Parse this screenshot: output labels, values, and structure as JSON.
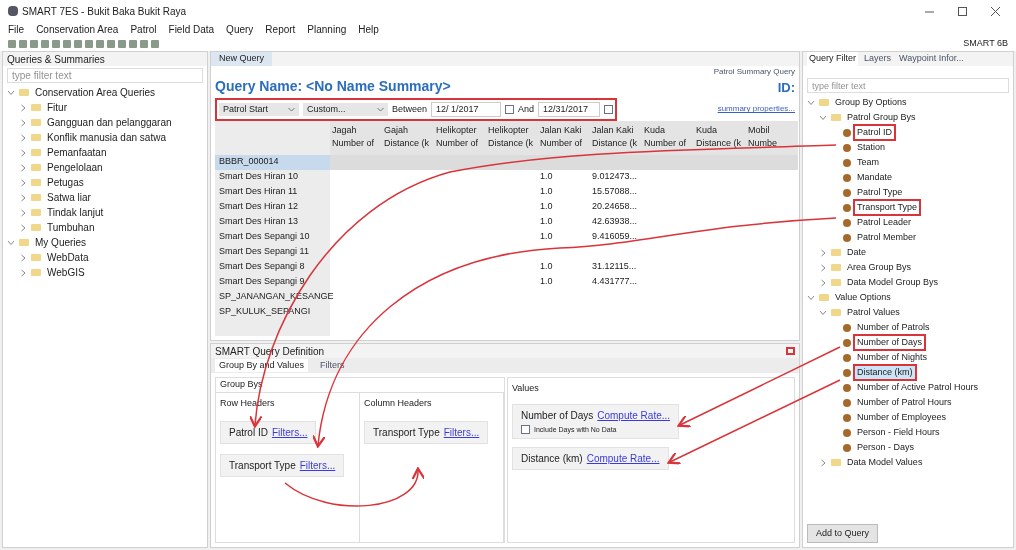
{
  "window": {
    "title": "SMART 7ES - Bukit Baka Bukit Raya"
  },
  "menu": [
    "File",
    "Conservation Area",
    "Patrol",
    "Field Data",
    "Query",
    "Report",
    "Planning",
    "Help"
  ],
  "toolbar_right": "SMART 6B",
  "left_panel": {
    "title": "Queries & Summaries",
    "filter_placeholder": "type filter text",
    "tree": [
      {
        "label": "Conservation Area Queries",
        "expanded": true,
        "children": [
          {
            "label": "Fitur",
            "expanded": false
          },
          {
            "label": "Gangguan dan pelanggaran",
            "expanded": false
          },
          {
            "label": "Konflik manusia dan satwa",
            "expanded": false
          },
          {
            "label": "Pemanfaatan",
            "expanded": false
          },
          {
            "label": "Pengelolaan",
            "expanded": false
          },
          {
            "label": "Petugas",
            "expanded": false
          },
          {
            "label": "Satwa liar",
            "expanded": false
          },
          {
            "label": "Tindak lanjut",
            "expanded": false
          },
          {
            "label": "Tumbuhan",
            "expanded": false
          }
        ]
      },
      {
        "label": "My Queries",
        "expanded": true,
        "children": [
          {
            "label": "WebData",
            "expanded": false
          },
          {
            "label": "WebGIS",
            "expanded": false
          }
        ]
      }
    ]
  },
  "editor": {
    "tab": "New Query",
    "query_name": "Query Name: <No Name Summary>",
    "query_type": "Patrol Summary Query",
    "id_label": "ID:",
    "filter_row": {
      "highlighted": true,
      "date_field": "Patrol Start",
      "range": "Custom...",
      "between_label": "Between",
      "start_date": "12/ 1/2017",
      "and_label": "And",
      "end_date": "12/31/2017"
    },
    "properties_link": "summary properties...",
    "table": {
      "columns": [
        [
          "Jagah",
          "Number of"
        ],
        [
          "Gajah",
          "Distance (k"
        ],
        [
          "Helikopter",
          "Number of"
        ],
        [
          "Helikopter",
          "Distance (k"
        ],
        [
          "Jalan Kaki",
          "Number of"
        ],
        [
          "Jalan Kaki",
          "Distance (k"
        ],
        [
          "Kuda",
          "Number of"
        ],
        [
          "Kuda",
          "Distance (k"
        ],
        [
          "Mobil",
          "Numbe"
        ]
      ],
      "rows": [
        {
          "label": "BBBR_000014",
          "selected": true
        },
        {
          "label": "Smart Des Hiran 10",
          "selected": false,
          "walk_number": "1.0",
          "walk_distance": "9.012473..."
        },
        {
          "label": "Smart Des Hiran 11",
          "selected": false,
          "walk_number": "1.0",
          "walk_distance": "15.57088..."
        },
        {
          "label": "Smart Des Hiran 12",
          "selected": false,
          "walk_number": "1.0",
          "walk_distance": "20.24658..."
        },
        {
          "label": "Smart Des Hiran 13",
          "selected": false,
          "walk_number": "1.0",
          "walk_distance": "42.63938..."
        },
        {
          "label": "Smart Des Sepangi 10",
          "selected": false,
          "walk_number": "1.0",
          "walk_distance": "9.416059..."
        },
        {
          "label": "Smart Des Sepangi 11",
          "selected": false
        },
        {
          "label": "Smart Des Sepangi 8",
          "selected": false,
          "walk_number": "1.0",
          "walk_distance": "31.12115..."
        },
        {
          "label": "Smart Des Sepangi 9",
          "selected": false,
          "walk_number": "1.0",
          "walk_distance": "4.431777..."
        },
        {
          "label": "SP_JANANGAN_KESANGE",
          "selected": false
        },
        {
          "label": "SP_KULUK_SEPANGI",
          "selected": false
        }
      ]
    }
  },
  "definition": {
    "title": "SMART Query Definition",
    "tabs": [
      {
        "label": "Group By and Values",
        "selected": true
      },
      {
        "label": "Filters",
        "selected": false
      }
    ],
    "group_bys": {
      "title": "Group Bys",
      "row_headers": {
        "title": "Row Headers",
        "items": [
          {
            "label": "Patrol ID",
            "link": "Filters..."
          },
          {
            "label": "Transport Type",
            "link": "Filters..."
          }
        ]
      },
      "column_headers": {
        "title": "Column Headers",
        "items": [
          {
            "label": "Transport Type",
            "link": "Filters..."
          }
        ]
      }
    },
    "values": {
      "title": "Values",
      "items": [
        {
          "label": "Number of Days",
          "link": "Compute Rate...",
          "option": {
            "label": "Include Days with No Data",
            "checked": false
          }
        },
        {
          "label": "Distance (km)",
          "link": "Compute Rate..."
        }
      ]
    }
  },
  "right_panel": {
    "tabs": [
      {
        "label": "Query Filter",
        "selected": true
      },
      {
        "label": "Layers",
        "selected": false
      },
      {
        "label": "Waypoint Infor...",
        "selected": false
      }
    ],
    "filter_placeholder": "type filter text",
    "tree": [
      {
        "label": "Group By Options",
        "expanded": true,
        "children": [
          {
            "label": "Patrol Group Bys",
            "expanded": true,
            "children": [
              {
                "label": "Patrol ID",
                "highlighted": true,
                "selected": false
              },
              {
                "label": "Station",
                "highlighted": false,
                "selected": false
              },
              {
                "label": "Team",
                "highlighted": false,
                "selected": false
              },
              {
                "label": "Mandate",
                "highlighted": false,
                "selected": false
              },
              {
                "label": "Patrol Type",
                "highlighted": false,
                "selected": false
              },
              {
                "label": "Transport Type",
                "highlighted": true,
                "selected": false
              },
              {
                "label": "Patrol Leader",
                "highlighted": false,
                "selected": false
              },
              {
                "label": "Patrol Member",
                "highlighted": false,
                "selected": false
              }
            ]
          },
          {
            "label": "Date",
            "expanded": false
          },
          {
            "label": "Area Group Bys",
            "expanded": false
          },
          {
            "label": "Data Model Group Bys",
            "expanded": false
          }
        ]
      },
      {
        "label": "Value Options",
        "expanded": true,
        "children": [
          {
            "label": "Patrol Values",
            "expanded": true,
            "children": [
              {
                "label": "Number of Patrols",
                "highlighted": false,
                "selected": false
              },
              {
                "label": "Number of Days",
                "highlighted": true,
                "selected": false
              },
              {
                "label": "Number of Nights",
                "highlighted": false,
                "selected": false
              },
              {
                "label": "Distance (km)",
                "highlighted": true,
                "selected": true
              },
              {
                "label": "Number of Active Patrol Hours",
                "highlighted": false,
                "selected": false
              },
              {
                "label": "Number of Patrol Hours",
                "highlighted": false,
                "selected": false
              },
              {
                "label": "Number of Employees",
                "highlighted": false,
                "selected": false
              },
              {
                "label": "Person - Field Hours",
                "highlighted": false,
                "selected": false
              },
              {
                "label": "Person - Days",
                "highlighted": false,
                "selected": false
              }
            ]
          },
          {
            "label": "Data Model Values",
            "expanded": false
          }
        ]
      }
    ],
    "add_button": "Add to Query"
  }
}
